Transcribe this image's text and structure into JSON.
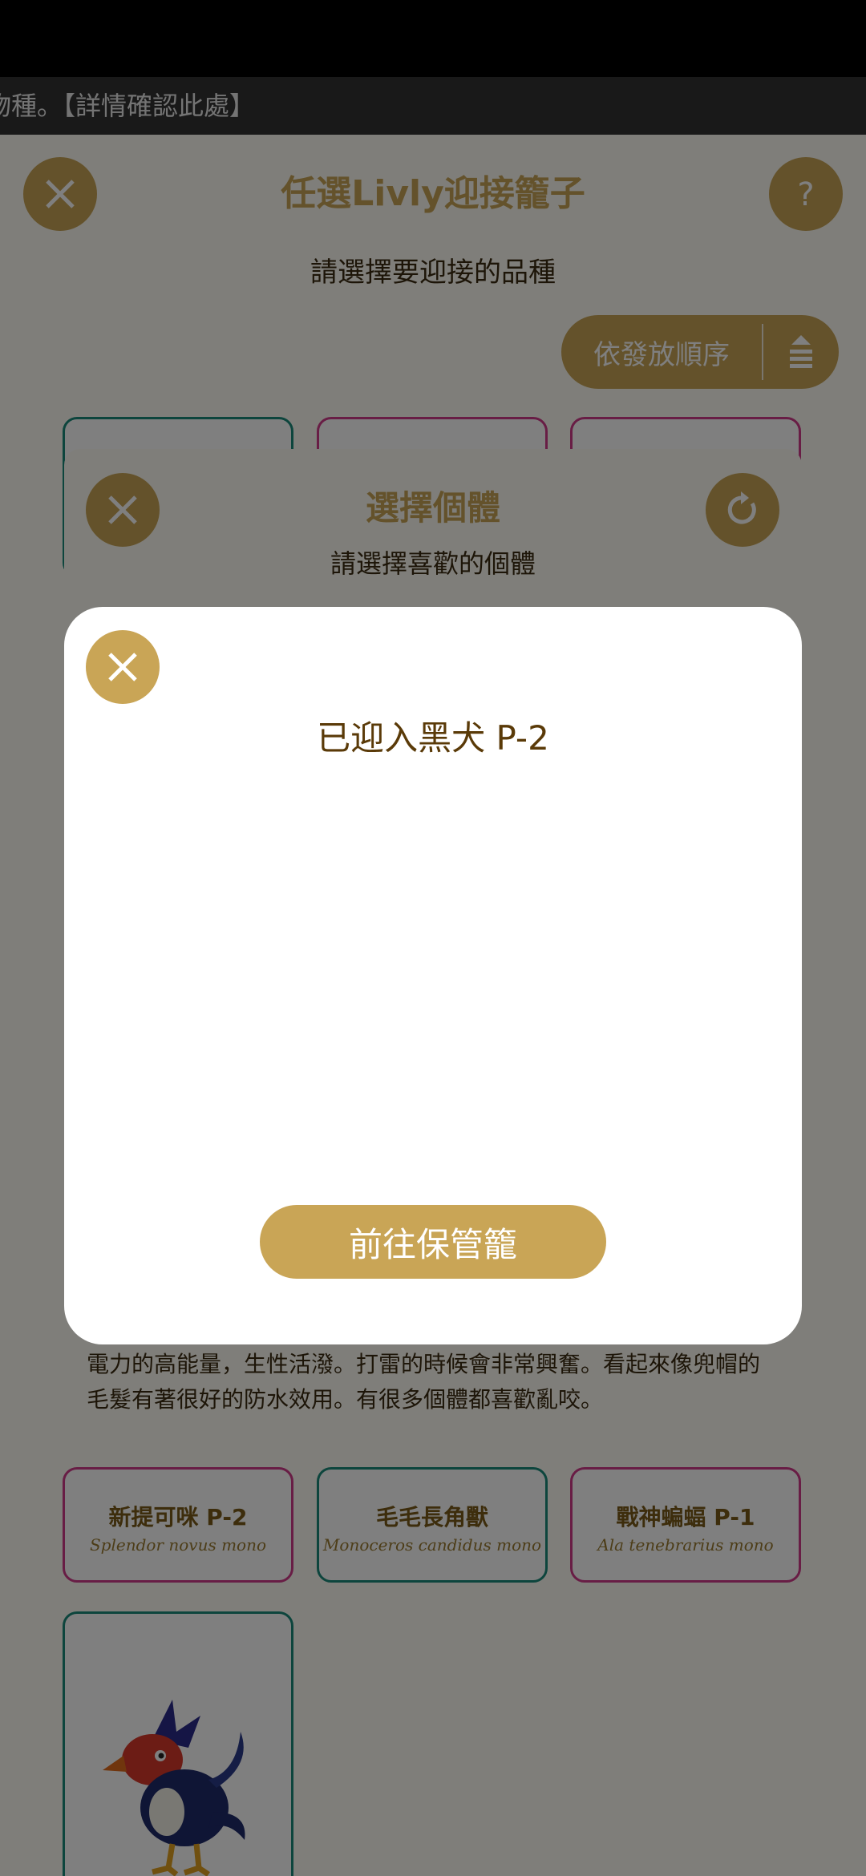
{
  "ticker": {
    "text": "物種。【詳情確認此處】"
  },
  "header": {
    "title": "任選Livly迎接籠子",
    "subtitle": "請選擇要迎接的品種"
  },
  "sort": {
    "label": "依發放順序"
  },
  "panel": {
    "title": "選擇個體",
    "subtitle": "請選擇喜歡的個體",
    "description_line1": "電力的高能量，生性活潑。打雷的時候會非常興奮。看起來像兜帽的",
    "description_line2": "毛髮有著很好的防水效用。有很多個體都喜歡亂咬。"
  },
  "cards": [
    {
      "name": "新提可咪 P-2",
      "latin": "Splendor novus mono"
    },
    {
      "name": "毛毛長角獸",
      "latin": "Monoceros candidus mono"
    },
    {
      "name": "戰神蝙蝠 P-1",
      "latin": "Ala tenebrarius mono"
    }
  ],
  "modal": {
    "title": "已迎入黑犬 P-2",
    "button_label": "前往保管籠"
  },
  "colors": {
    "accent": "#c9a556",
    "teal_border": "#1a8a7a",
    "pink_border": "#d03a8a"
  },
  "icons": {
    "close": "close-icon",
    "help": "question-mark-icon",
    "refresh": "refresh-icon",
    "sort": "sort-icon"
  }
}
